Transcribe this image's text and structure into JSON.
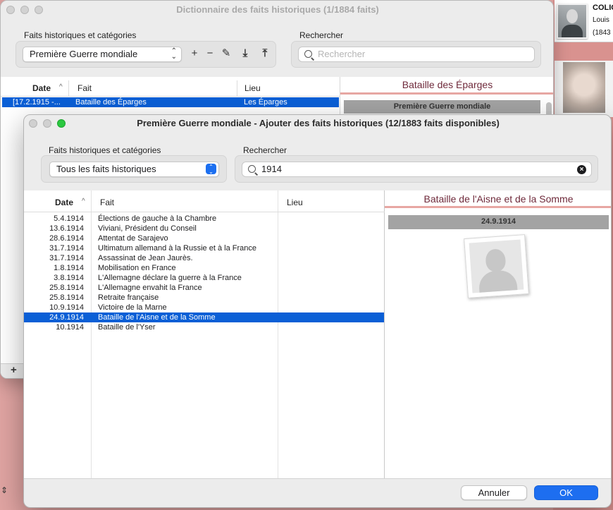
{
  "background_person": {
    "name": "COLIG",
    "first_name": "Louis",
    "year": "(1843"
  },
  "main_window": {
    "title": "Dictionnaire des faits historiques (1/1884 faits)",
    "category_label": "Faits historiques et catégories",
    "category_value": "Première Guerre mondiale",
    "search_label": "Rechercher",
    "search_placeholder": "Rechercher",
    "toolbar": {
      "add": "+",
      "remove": "−",
      "edit": "✎",
      "import": "⤓",
      "export": "⤒"
    },
    "columns": {
      "date": "Date",
      "fait": "Fait",
      "lieu": "Lieu"
    },
    "sort_indicator": "^",
    "selected_row": {
      "date": "[17.2.1915 -...",
      "fait": "Bataille des Éparges",
      "lieu": "Les Éparges"
    },
    "detail": {
      "title": "Bataille des Éparges",
      "category_bar": "Première Guerre mondiale"
    },
    "bottom_add": "+",
    "bottom_stepper": "⇕"
  },
  "dialog": {
    "title": "Première Guerre mondiale - Ajouter des faits historiques  (12/1883 faits disponibles)",
    "category_label": "Faits historiques et catégories",
    "category_value": "Tous les faits historiques",
    "search_label": "Rechercher",
    "search_value": "1914",
    "columns": {
      "date": "Date",
      "fait": "Fait",
      "lieu": "Lieu"
    },
    "sort_indicator": "^",
    "rows": [
      {
        "date": "5.4.1914",
        "fait": "Élections de gauche à la Chambre",
        "lieu": ""
      },
      {
        "date": "13.6.1914",
        "fait": "Viviani, Président du Conseil",
        "lieu": ""
      },
      {
        "date": "28.6.1914",
        "fait": "Attentat de Sarajevo",
        "lieu": ""
      },
      {
        "date": "31.7.1914",
        "fait": "Ultimatum allemand à la Russie et à la France",
        "lieu": ""
      },
      {
        "date": "31.7.1914",
        "fait": "Assassinat de Jean Jaurès.",
        "lieu": ""
      },
      {
        "date": "1.8.1914",
        "fait": "Mobilisation en France",
        "lieu": ""
      },
      {
        "date": "3.8.1914",
        "fait": "L'Allemagne déclare la guerre à la France",
        "lieu": ""
      },
      {
        "date": "25.8.1914",
        "fait": "L'Allemagne envahit la France",
        "lieu": ""
      },
      {
        "date": "25.8.1914",
        "fait": "Retraite française",
        "lieu": ""
      },
      {
        "date": "10.9.1914",
        "fait": "Victoire de la Marne",
        "lieu": ""
      },
      {
        "date": "24.9.1914",
        "fait": "Bataille de l'Aisne et de la Somme",
        "lieu": ""
      },
      {
        "date": "10.1914",
        "fait": "Bataille de l'Yser",
        "lieu": ""
      }
    ],
    "selected_index": 10,
    "detail": {
      "title": "Bataille de l'Aisne et de la Somme",
      "date_bar": "24.9.1914"
    },
    "buttons": {
      "cancel": "Annuler",
      "ok": "OK"
    }
  },
  "colors": {
    "selection": "#0a5fd6",
    "accent_button": "#1d6ef0",
    "detail_title": "#6f2a3b",
    "pink_rule": "#e7a7a3",
    "background": "#e0a4a2"
  }
}
